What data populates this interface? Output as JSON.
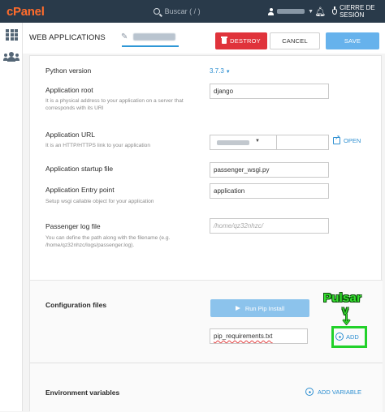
{
  "topbar": {
    "logo": "cPanel",
    "search_placeholder": "Buscar ( / )",
    "logout_label": "CIERRE DE SESIÓN"
  },
  "header": {
    "title": "WEB APPLICATIONS",
    "destroy_label": "DESTROY",
    "cancel_label": "CANCEL",
    "save_label": "SAVE"
  },
  "form": {
    "python_version": {
      "label": "Python version",
      "value": "3.7.3"
    },
    "app_root": {
      "label": "Application root",
      "help": "It is a physical address to your application on a server that corresponds with its URI",
      "value": "django"
    },
    "app_url": {
      "label": "Application URL",
      "help": "It is an HTTP/HTTPS link to your application",
      "open_label": "OPEN"
    },
    "startup_file": {
      "label": "Application startup file",
      "value": "passenger_wsgi.py"
    },
    "entry_point": {
      "label": "Application Entry point",
      "help": "Setup wsgi callable object for your application",
      "value": "application"
    },
    "log_file": {
      "label": "Passenger log file",
      "help": "You can define the path along with the filename (e.g. /home/qz32nhzc/logs/passenger.log).",
      "placeholder": "/home/qz32nhzc/"
    }
  },
  "config": {
    "label": "Configuration files",
    "pip_button": "Run Pip Install",
    "file_value": "pip_requirements.txt",
    "add_label": "ADD"
  },
  "env": {
    "label": "Environment variables",
    "add_label": "ADD VARIABLE"
  },
  "annotation": {
    "text": "Pulsar",
    "mark": "V",
    "color": "#35e02f"
  },
  "colors": {
    "topbar": "#293a4a",
    "brand": "#ff6c2c",
    "destroy": "#e0333b",
    "save": "#66b2ec",
    "link": "#2e8fd1"
  }
}
